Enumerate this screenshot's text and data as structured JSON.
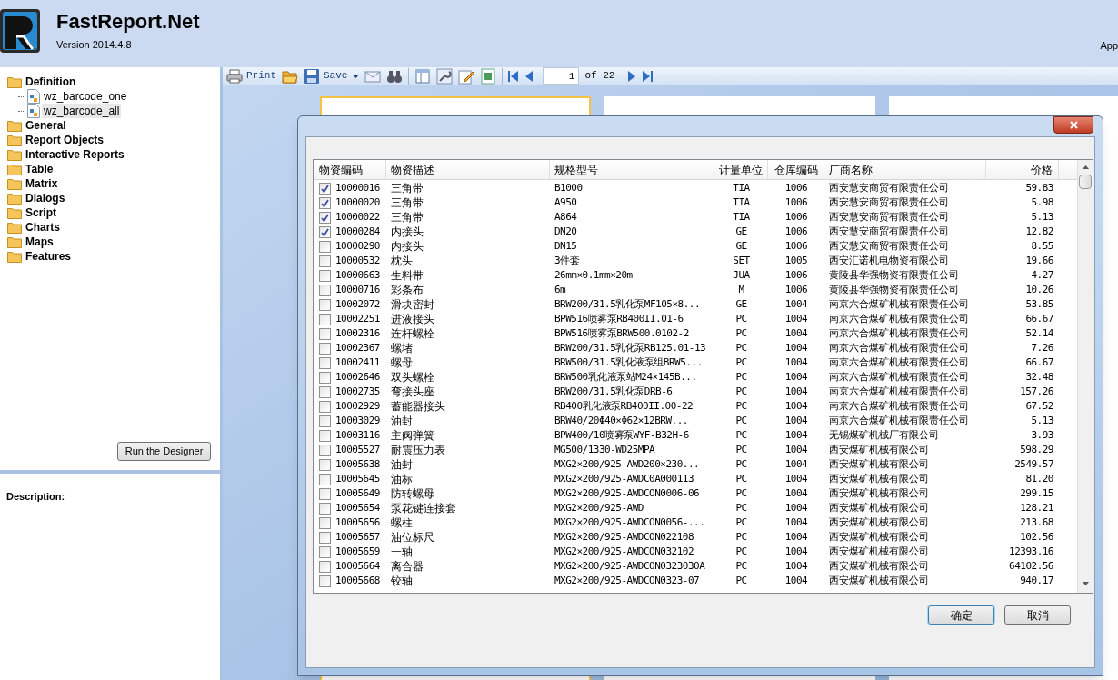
{
  "header": {
    "title": "FastReport.Net",
    "version": "Version 2014.4.8",
    "corner_text": "App"
  },
  "tree": [
    {
      "label": "Definition",
      "children": [
        {
          "label": "wz_barcode_one",
          "selected": false
        },
        {
          "label": "wz_barcode_all",
          "selected": true
        }
      ]
    },
    {
      "label": "General"
    },
    {
      "label": "Report Objects"
    },
    {
      "label": "Interactive Reports"
    },
    {
      "label": "Table"
    },
    {
      "label": "Matrix"
    },
    {
      "label": "Dialogs"
    },
    {
      "label": "Script"
    },
    {
      "label": "Charts"
    },
    {
      "label": "Maps"
    },
    {
      "label": "Features"
    }
  ],
  "run_button": "Run the Designer",
  "description_label": "Description:",
  "toolbar": {
    "print": "Print",
    "save": "Save",
    "page": "1",
    "page_count": "of 22"
  },
  "dialog": {
    "columns": [
      "物资编码",
      "物资描述",
      "规格型号",
      "计量单位",
      "仓库编码",
      "厂商名称",
      "价格"
    ],
    "rows": [
      {
        "checked": true,
        "code": "10000016",
        "desc": "三角带",
        "spec": "B1000",
        "unit": "TIA",
        "warehouse": "1006",
        "vendor": "西安慧安商贸有限责任公司",
        "price": "59.83"
      },
      {
        "checked": true,
        "code": "10000020",
        "desc": "三角带",
        "spec": "A950",
        "unit": "TIA",
        "warehouse": "1006",
        "vendor": "西安慧安商贸有限责任公司",
        "price": "5.98"
      },
      {
        "checked": true,
        "code": "10000022",
        "desc": "三角带",
        "spec": "A864",
        "unit": "TIA",
        "warehouse": "1006",
        "vendor": "西安慧安商贸有限责任公司",
        "price": "5.13"
      },
      {
        "checked": true,
        "code": "10000284",
        "desc": "内接头",
        "spec": "DN20",
        "unit": "GE",
        "warehouse": "1006",
        "vendor": "西安慧安商贸有限责任公司",
        "price": "12.82"
      },
      {
        "checked": false,
        "code": "10000290",
        "desc": "内接头",
        "spec": "DN15",
        "unit": "GE",
        "warehouse": "1006",
        "vendor": "西安慧安商贸有限责任公司",
        "price": "8.55"
      },
      {
        "checked": false,
        "code": "10000532",
        "desc": "枕头",
        "spec": "3件套",
        "unit": "SET",
        "warehouse": "1005",
        "vendor": "西安汇诺机电物资有限公司",
        "price": "19.66"
      },
      {
        "checked": false,
        "code": "10000663",
        "desc": "生料带",
        "spec": "26mm×0.1mm×20m",
        "unit": "JUA",
        "warehouse": "1006",
        "vendor": "黄陵县华强物资有限责任公司",
        "price": "4.27"
      },
      {
        "checked": false,
        "code": "10000716",
        "desc": "彩条布",
        "spec": "6m",
        "unit": "M",
        "warehouse": "1006",
        "vendor": "黄陵县华强物资有限责任公司",
        "price": "10.26"
      },
      {
        "checked": false,
        "code": "10002072",
        "desc": "滑块密封",
        "spec": "BRW200/31.5乳化泵MF105×8...",
        "unit": "GE",
        "warehouse": "1004",
        "vendor": "南京六合煤矿机械有限责任公司",
        "price": "53.85"
      },
      {
        "checked": false,
        "code": "10002251",
        "desc": "进液接头",
        "spec": "BPW516喷雾泵RB400II.01-6",
        "unit": "PC",
        "warehouse": "1004",
        "vendor": "南京六合煤矿机械有限责任公司",
        "price": "66.67"
      },
      {
        "checked": false,
        "code": "10002316",
        "desc": "连杆螺栓",
        "spec": "BPW516喷雾泵BRW500.0102-2",
        "unit": "PC",
        "warehouse": "1004",
        "vendor": "南京六合煤矿机械有限责任公司",
        "price": "52.14"
      },
      {
        "checked": false,
        "code": "10002367",
        "desc": "螺堵",
        "spec": "BRW200/31.5乳化泵RB125.01-13",
        "unit": "PC",
        "warehouse": "1004",
        "vendor": "南京六合煤矿机械有限责任公司",
        "price": "7.26"
      },
      {
        "checked": false,
        "code": "10002411",
        "desc": "螺母",
        "spec": "BRW500/31.5乳化液泵组BRW5...",
        "unit": "PC",
        "warehouse": "1004",
        "vendor": "南京六合煤矿机械有限责任公司",
        "price": "66.67"
      },
      {
        "checked": false,
        "code": "10002646",
        "desc": "双头螺栓",
        "spec": "BRW500乳化液泵站M24×145B...",
        "unit": "PC",
        "warehouse": "1004",
        "vendor": "南京六合煤矿机械有限责任公司",
        "price": "32.48"
      },
      {
        "checked": false,
        "code": "10002735",
        "desc": "弯接头座",
        "spec": "BRW200/31.5乳化泵DRB-6",
        "unit": "PC",
        "warehouse": "1004",
        "vendor": "南京六合煤矿机械有限责任公司",
        "price": "157.26"
      },
      {
        "checked": false,
        "code": "10002929",
        "desc": "蓄能器接头",
        "spec": "RB400乳化液泵RB400II.00-22",
        "unit": "PC",
        "warehouse": "1004",
        "vendor": "南京六合煤矿机械有限责任公司",
        "price": "67.52"
      },
      {
        "checked": false,
        "code": "10003029",
        "desc": "油封",
        "spec": "BRW40/20Φ40×Φ62×12BRW...",
        "unit": "PC",
        "warehouse": "1004",
        "vendor": "南京六合煤矿机械有限责任公司",
        "price": "5.13"
      },
      {
        "checked": false,
        "code": "10003116",
        "desc": "主阀弹簧",
        "spec": "BPW400/10喷雾泵WYF-B32H-6",
        "unit": "PC",
        "warehouse": "1004",
        "vendor": "无锡煤矿机械厂有限公司",
        "price": "3.93"
      },
      {
        "checked": false,
        "code": "10005527",
        "desc": "耐震压力表",
        "spec": "MG500/1330-WD25MPA",
        "unit": "PC",
        "warehouse": "1004",
        "vendor": "西安煤矿机械有限公司",
        "price": "598.29"
      },
      {
        "checked": false,
        "code": "10005638",
        "desc": "油封",
        "spec": "MXG2×200/925-AWD200×230...",
        "unit": "PC",
        "warehouse": "1004",
        "vendor": "西安煤矿机械有限公司",
        "price": "2549.57"
      },
      {
        "checked": false,
        "code": "10005645",
        "desc": "油标",
        "spec": "MXG2×200/925-AWDC0A000113",
        "unit": "PC",
        "warehouse": "1004",
        "vendor": "西安煤矿机械有限公司",
        "price": "81.20"
      },
      {
        "checked": false,
        "code": "10005649",
        "desc": "防转螺母",
        "spec": "MXG2×200/925-AWDCON0006-06",
        "unit": "PC",
        "warehouse": "1004",
        "vendor": "西安煤矿机械有限公司",
        "price": "299.15"
      },
      {
        "checked": false,
        "code": "10005654",
        "desc": "泵花键连接套",
        "spec": "MXG2×200/925-AWD",
        "unit": "PC",
        "warehouse": "1004",
        "vendor": "西安煤矿机械有限公司",
        "price": "128.21"
      },
      {
        "checked": false,
        "code": "10005656",
        "desc": "螺柱",
        "spec": "MXG2×200/925-AWDCON0056-...",
        "unit": "PC",
        "warehouse": "1004",
        "vendor": "西安煤矿机械有限公司",
        "price": "213.68"
      },
      {
        "checked": false,
        "code": "10005657",
        "desc": "油位标尺",
        "spec": "MXG2×200/925-AWDCON022108",
        "unit": "PC",
        "warehouse": "1004",
        "vendor": "西安煤矿机械有限公司",
        "price": "102.56"
      },
      {
        "checked": false,
        "code": "10005659",
        "desc": "一轴",
        "spec": "MXG2×200/925-AWDCON032102",
        "unit": "PC",
        "warehouse": "1004",
        "vendor": "西安煤矿机械有限公司",
        "price": "12393.16"
      },
      {
        "checked": false,
        "code": "10005664",
        "desc": "离合器",
        "spec": "MXG2×200/925-AWDCON0323030A",
        "unit": "PC",
        "warehouse": "1004",
        "vendor": "西安煤矿机械有限公司",
        "price": "64102.56"
      },
      {
        "checked": false,
        "code": "10005668",
        "desc": "铰轴",
        "spec": "MXG2×200/925-AWDCON0323-07",
        "unit": "PC",
        "warehouse": "1004",
        "vendor": "西安煤矿机械有限公司",
        "price": "940.17"
      }
    ],
    "buttons": [
      "确定",
      "取消"
    ]
  }
}
